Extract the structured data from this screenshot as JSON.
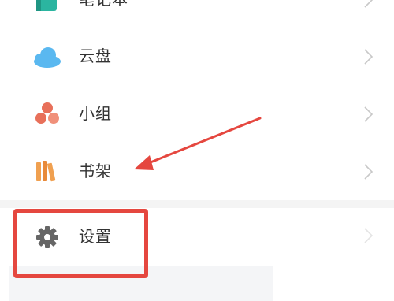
{
  "menu": {
    "items": [
      {
        "label": "笔记本",
        "icon": "notebook-icon"
      },
      {
        "label": "云盘",
        "icon": "cloud-icon"
      },
      {
        "label": "小组",
        "icon": "group-icon"
      },
      {
        "label": "书架",
        "icon": "bookshelf-icon"
      },
      {
        "label": "设置",
        "icon": "gear-icon"
      }
    ]
  },
  "annotation": {
    "highlight_color": "#e5473f",
    "highlighted_item": "设置"
  },
  "colors": {
    "notebook": "#2bb5a0",
    "cloud": "#5ab8f0",
    "group": "#e8705a",
    "bookshelf": "#f0a050",
    "settings": "#666666",
    "chevron": "#c8c8c8"
  }
}
